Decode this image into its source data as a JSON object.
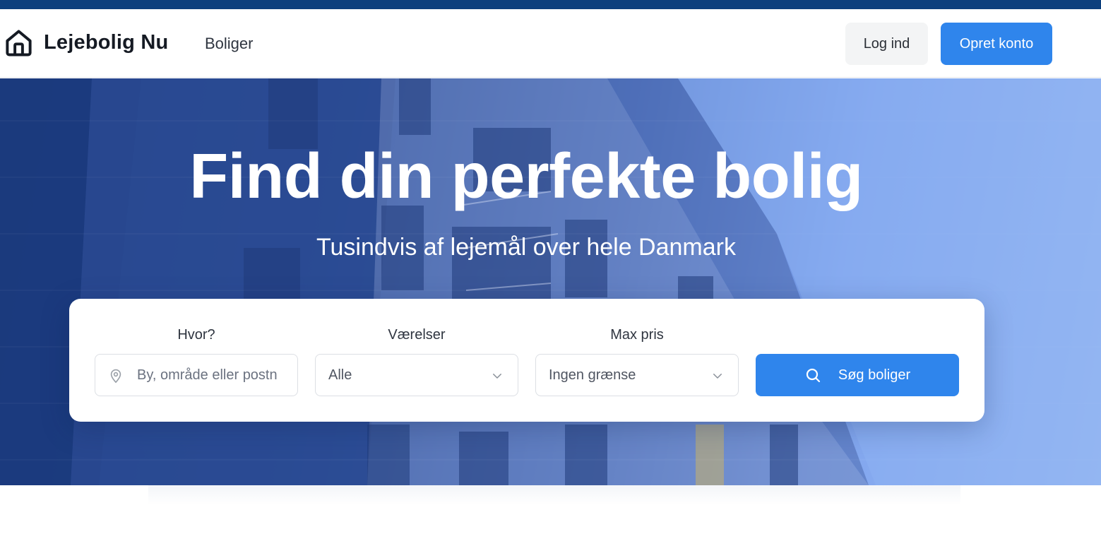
{
  "brand": {
    "name": "Lejebolig Nu",
    "icon": "house-icon"
  },
  "nav": {
    "items": [
      {
        "label": "Boliger"
      }
    ]
  },
  "auth": {
    "login_label": "Log ind",
    "signup_label": "Opret konto"
  },
  "hero": {
    "title": "Find din perfekte bolig",
    "subtitle": "Tusindvis af lejemål over hele Danmark"
  },
  "search": {
    "where_label": "Hvor?",
    "where_placeholder": "By, område eller postnummer",
    "where_visible": "By, område eller postn",
    "rooms_label": "Værelser",
    "rooms_value": "Alle",
    "price_label": "Max pris",
    "price_value": "Ingen grænse",
    "submit_label": "Søg boliger"
  },
  "colors": {
    "brand_dark": "#0c3f7d",
    "accent": "#2f85ec",
    "text_dark": "#151a23"
  }
}
